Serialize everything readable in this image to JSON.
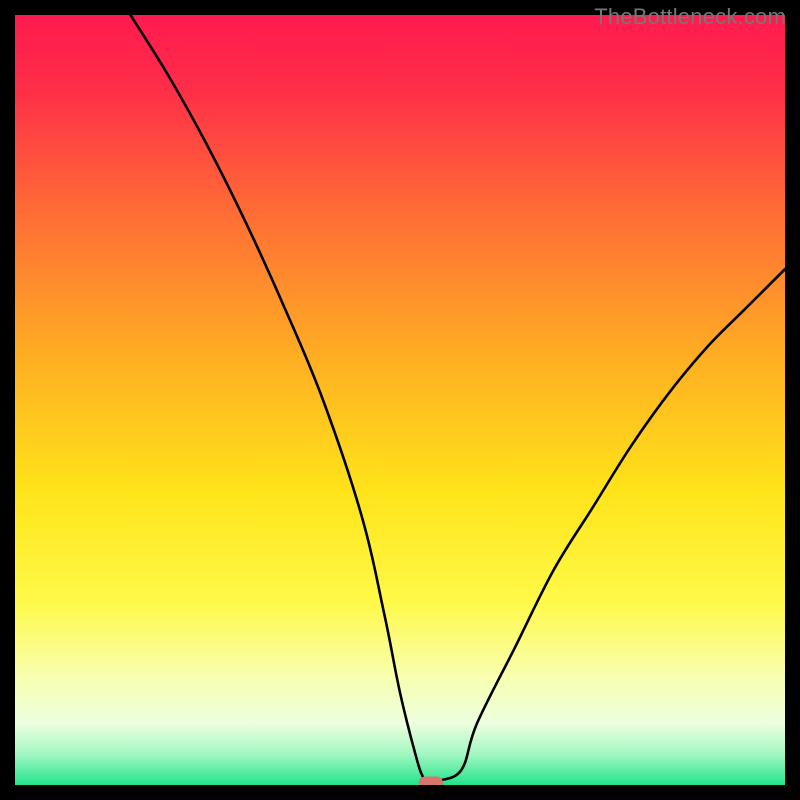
{
  "watermark": "TheBottleneck.com",
  "chart_data": {
    "type": "line",
    "title": "",
    "xlabel": "",
    "ylabel": "",
    "xlim": [
      0,
      100
    ],
    "ylim": [
      0,
      100
    ],
    "grid": false,
    "legend": false,
    "background": "gradient-red-yellow-green-with-black-border",
    "series": [
      {
        "name": "curve",
        "x": [
          15,
          20,
          25,
          30,
          35,
          40,
          45,
          48,
          50,
          52,
          53,
          54,
          55,
          58,
          60,
          65,
          70,
          75,
          80,
          85,
          90,
          95,
          100
        ],
        "y": [
          100,
          92,
          83,
          73,
          62,
          50,
          35,
          22,
          12,
          4,
          1,
          0,
          0.5,
          2,
          8,
          18,
          28,
          36,
          44,
          51,
          57,
          62,
          67
        ]
      }
    ],
    "marker": {
      "x": 54,
      "y": 0,
      "color": "#d6766c",
      "shape": "pill"
    },
    "notes": "Values are estimated from the figure; the curve descends steeply from top-left, reaches zero near x≈54, then rises more gently toward the right edge reaching roughly two-thirds height."
  }
}
